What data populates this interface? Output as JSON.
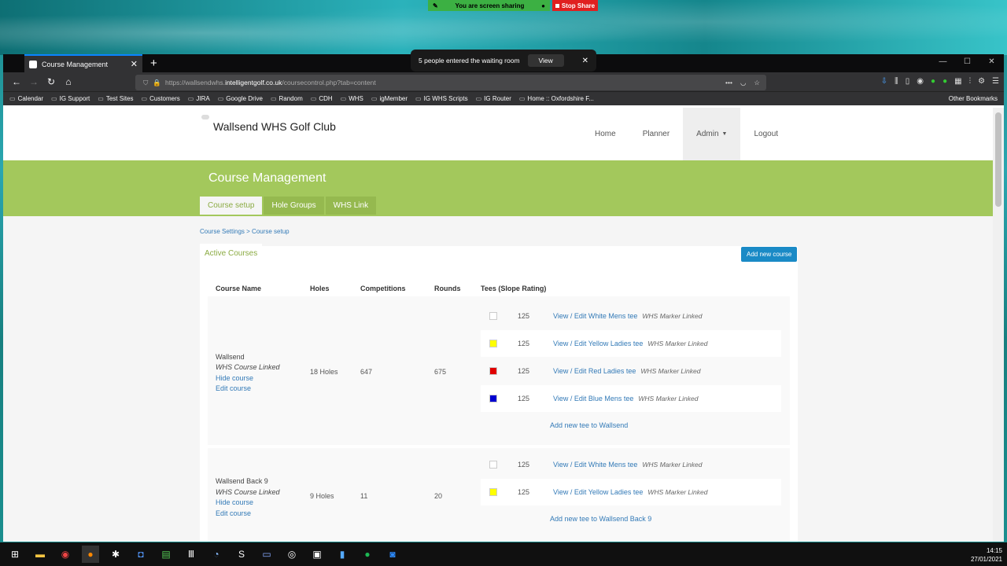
{
  "desktop": {
    "share_status": "You are screen sharing",
    "stop_share": "Stop Share"
  },
  "zoom_toast": {
    "message": "5 people entered the waiting room",
    "view_label": "View"
  },
  "browser": {
    "tab_title": "Course Management",
    "url_prefix": "https://wallsendwhs.",
    "url_domain": "intelligentgolf.co.uk",
    "url_path": "/coursecontrol.php?tab=content",
    "bookmarks": [
      "Calendar",
      "IG Support",
      "Test Sites",
      "Customers",
      "JIRA",
      "Google Drive",
      "Random",
      "CDH",
      "WHS",
      "igMember",
      "IG WHS Scripts",
      "IG Router",
      "Home :: Oxfordshire F..."
    ],
    "other_bookmarks": "Other Bookmarks"
  },
  "site": {
    "club_name": "Wallsend WHS Golf Club",
    "nav": [
      "Home",
      "Planner",
      "Admin",
      "Logout"
    ],
    "page_title": "Course Management",
    "tabs": [
      "Course setup",
      "Hole Groups",
      "WHS Link"
    ],
    "breadcrumb": "Course Settings > Course setup",
    "card_tab": "Active Courses",
    "add_course": "Add new course",
    "headers": [
      "Course Name",
      "Holes",
      "Competitions",
      "Rounds",
      "Tees (Slope Rating)"
    ],
    "courses": [
      {
        "name": "Wallsend",
        "whs": "WHS Course Linked",
        "hide": "Hide course",
        "edit": "Edit course",
        "holes": "18 Holes",
        "competitions": "647",
        "rounds": "675",
        "tees": [
          {
            "color": "#ffffff",
            "slope": "125",
            "link": "View / Edit White Mens tee",
            "marker": "WHS Marker Linked"
          },
          {
            "color": "#ffff00",
            "slope": "125",
            "link": "View / Edit Yellow Ladies tee",
            "marker": "WHS Marker Linked"
          },
          {
            "color": "#e00000",
            "slope": "125",
            "link": "View / Edit Red Ladies tee",
            "marker": "WHS Marker Linked"
          },
          {
            "color": "#0000d0",
            "slope": "125",
            "link": "View / Edit Blue Mens tee",
            "marker": "WHS Marker Linked"
          }
        ],
        "add_tee": "Add new tee to Wallsend"
      },
      {
        "name": "Wallsend Back 9",
        "whs": "WHS Course Linked",
        "hide": "Hide course",
        "edit": "Edit course",
        "holes": "9 Holes",
        "competitions": "11",
        "rounds": "20",
        "tees": [
          {
            "color": "#ffffff",
            "slope": "125",
            "link": "View / Edit White Mens tee",
            "marker": "WHS Marker Linked"
          },
          {
            "color": "#ffff00",
            "slope": "125",
            "link": "View / Edit Yellow Ladies tee",
            "marker": "WHS Marker Linked"
          }
        ],
        "add_tee": "Add new tee to Wallsend Back 9"
      }
    ]
  },
  "taskbar": {
    "time": "14:15",
    "date": "27/01/2021"
  }
}
